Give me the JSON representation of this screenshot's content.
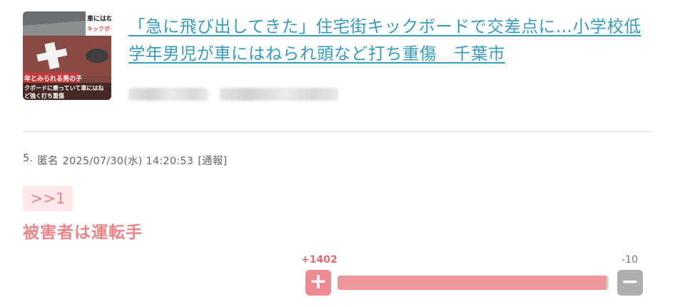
{
  "article": {
    "title": "「急に飛び出してきた」住宅街キックボードで交差点に…小学校低学年男児が車にはねられ頭など打ち重傷　千葉市",
    "source_blurred": [
      "██████",
      "████████████"
    ],
    "thumbnail": {
      "caption_top": "車にはねら",
      "caption_top2": "キックボード",
      "caption_line1": "年とみられる男の子",
      "caption_line2": "クボードに乗っていて車にはね",
      "caption_line3": "ど強く打ち重傷"
    }
  },
  "comment": {
    "number": "5.",
    "author": "匿名",
    "datetime": "2025/07/30(水) 14:20:53",
    "report_label": "[通報]",
    "reply_anchor": ">>1",
    "body": "被害者は運転手"
  },
  "votes": {
    "plus_label": "+1402",
    "minus_label": "-10",
    "plus": 1402,
    "minus": 10,
    "plus_icon": "+",
    "minus_icon": "−",
    "plus_color": "#ee8a92",
    "minus_color": "#aeaeae"
  }
}
